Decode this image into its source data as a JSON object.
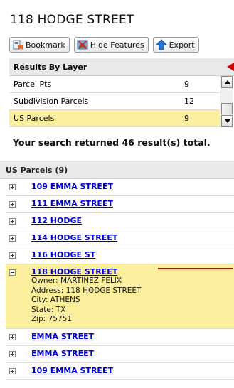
{
  "header": {
    "title": "118 HODGE STREET"
  },
  "toolbar": {
    "bookmark_label": "Bookmark",
    "hide_label": "Hide Features",
    "export_label": "Export"
  },
  "layers": {
    "heading": "Results By Layer",
    "rows": [
      {
        "name": "Parcel Pts",
        "count": "9"
      },
      {
        "name": "Subdivision Parcels",
        "count": "12"
      },
      {
        "name": "US Parcels",
        "count": "9",
        "selected": true
      }
    ]
  },
  "summary": "Your search returned 46 result(s) total.",
  "group": {
    "title": "US Parcels (9)"
  },
  "results": [
    {
      "label": "109 EMMA STREET"
    },
    {
      "label": "111 EMMA STREET"
    },
    {
      "label": "112 HODGE"
    },
    {
      "label": "114 HODGE STREET"
    },
    {
      "label": "116 HODGE ST"
    },
    {
      "label": "118 HODGE STREET",
      "expanded": true,
      "details": {
        "owner": "Owner: MARTINEZ FELIX",
        "address": "Address: 118 HODGE STREET",
        "city": "City: ATHENS",
        "state": "State: TX",
        "zip": "Zip: 75751"
      }
    },
    {
      "label": "EMMA STREET"
    },
    {
      "label": "EMMA STREET"
    },
    {
      "label": "109 EMMA STREET"
    }
  ],
  "colors": {
    "selected_bg": "#fbef9d",
    "link": "#0000cc",
    "annotation": "#d40000"
  }
}
